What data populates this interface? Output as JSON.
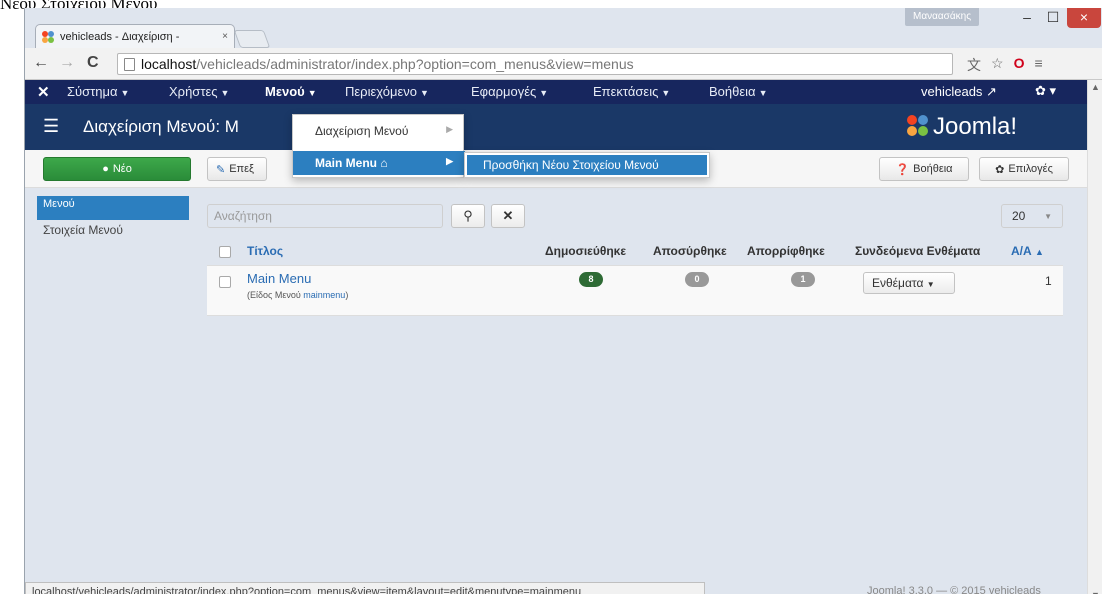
{
  "doc_caption": "Νέου Στοιχείου Μενού",
  "window": {
    "user_badge": "Μαναασάκης",
    "tab_title": "vehicleads - Διαχείριση - ",
    "tab_close": "×",
    "min": "–",
    "max": "☐",
    "close": "×"
  },
  "browser": {
    "back": "←",
    "forward": "→",
    "reload": "C",
    "url_host": "localhost",
    "url_path": "/vehicleads/administrator/index.php?option=com_menus&view=menus",
    "translate_icon": "文",
    "star_icon": "☆",
    "opera_icon": "O",
    "menu_icon": "≡",
    "status_url": "localhost/vehicleads/administrator/index.php?option=com_menus&view=item&layout=edit&menutype=mainmenu"
  },
  "nav": {
    "logo": "✕",
    "items": [
      "Σύστημα",
      "Χρήστες",
      "Μενού",
      "Περιεχόμενο",
      "Εφαρμογές",
      "Επεκτάσεις",
      "Βοήθεια"
    ],
    "site_name": "vehicleads ↗",
    "gear": "✿ ▾"
  },
  "header": {
    "title": "Διαχείριση Μενού: Μ",
    "brand": "Joomla!"
  },
  "subtoolbar": {
    "new": "Νέο",
    "edit": "Επεξ",
    "help": "Βοήθεια",
    "options": "Επιλογές"
  },
  "dropdown": {
    "item1": "Διαχείριση Μενού",
    "item2": "Main Menu",
    "submenu_item": "Προσθήκη Νέου Στοιχείου Μενού"
  },
  "sidebar": {
    "items": [
      "Μενού",
      "Στοιχεία Μενού"
    ]
  },
  "filters": {
    "search_placeholder": "Αναζήτηση",
    "limit": "20"
  },
  "table": {
    "headers": [
      "Τίτλος",
      "Δημοσιεύθηκε",
      "Αποσύρθηκε",
      "Απορρίφθηκε",
      "Συνδεόμενα Ενθέματα",
      "Α/Α"
    ],
    "rows": [
      {
        "title": "Main Menu",
        "subtitle_prefix": "(Είδος Μενού ",
        "subtitle_type": "mainmenu",
        "subtitle_suffix": ")",
        "published": "8",
        "unpublished": "0",
        "trashed": "1",
        "modules_button": "Ενθέματα",
        "id": "1"
      }
    ]
  },
  "footer": "Joomla! 3.3.0 — © 2015 vehicleads"
}
